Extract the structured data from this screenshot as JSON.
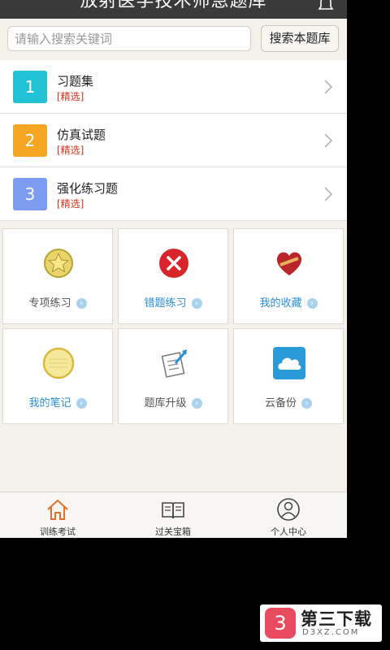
{
  "app": {
    "title": "放射医学技术师急题库",
    "icons": {
      "notification": "bell-icon"
    }
  },
  "search": {
    "placeholder": "请输入搜索关键词",
    "button_label": "搜索本题库"
  },
  "list": [
    {
      "number": "1",
      "title": "习题集",
      "tag": "[精选]",
      "color": "#22c3d6"
    },
    {
      "number": "2",
      "title": "仿真试题",
      "tag": "[精选]",
      "color": "#f5a623"
    },
    {
      "number": "3",
      "title": "强化练习题",
      "tag": "[精选]",
      "color": "#7b9cf0"
    }
  ],
  "grid": [
    {
      "label": "专项练习",
      "icon": "star-badge-icon",
      "highlight": false
    },
    {
      "label": "错题练习",
      "icon": "error-x-icon",
      "highlight": true
    },
    {
      "label": "我的收藏",
      "icon": "heart-icon",
      "highlight": true
    },
    {
      "label": "我的笔记",
      "icon": "notepad-icon",
      "highlight": true
    },
    {
      "label": "题库升级",
      "icon": "upgrade-doc-icon",
      "highlight": false
    },
    {
      "label": "云备份",
      "icon": "cloud-icon",
      "highlight": false
    }
  ],
  "tabs": [
    {
      "label": "训练考试",
      "icon": "home-icon",
      "active": true
    },
    {
      "label": "过关宝箱",
      "icon": "book-icon",
      "active": false
    },
    {
      "label": "个人中心",
      "icon": "user-icon",
      "active": false
    }
  ],
  "watermark": {
    "logo": "3",
    "title": "第三下载",
    "subtitle": "D3XZ.COM"
  }
}
